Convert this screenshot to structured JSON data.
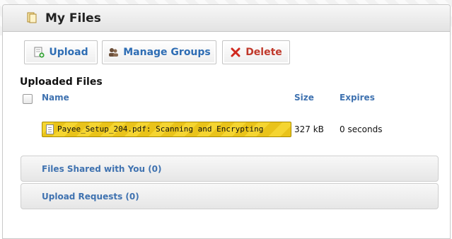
{
  "header": {
    "title": "My Files",
    "icon": "folder-icon"
  },
  "toolbar": {
    "upload_label": "Upload",
    "manage_groups_label": "Manage Groups",
    "delete_label": "Delete"
  },
  "uploaded": {
    "title": "Uploaded Files",
    "columns": {
      "name": "Name",
      "size": "Size",
      "expires": "Expires"
    },
    "files": [
      {
        "label": "Payee_Setup_204.pdf: Scanning and Encrypting",
        "size": "327 kB",
        "expires": "0 seconds",
        "status_color": "#f0cf2a"
      }
    ]
  },
  "sections": {
    "shared": "Files Shared with You (0)",
    "requests": "Upload Requests (0)"
  },
  "colors": {
    "link": "#3f72b0",
    "delete": "#c0392b",
    "progress": "#f0cf2a"
  }
}
